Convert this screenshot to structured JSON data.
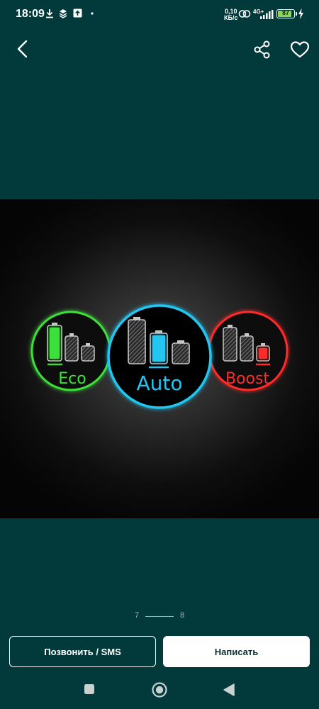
{
  "status_bar": {
    "time": "18:09",
    "net_speed_value": "0,10",
    "net_speed_unit": "КБ/с",
    "net_type": "4G+",
    "battery_level": 87,
    "battery_text": "87",
    "icons": [
      "download-icon",
      "layers-icon",
      "upload-box-icon",
      "dot-icon",
      "link-icon",
      "signal-icon",
      "charging-icon"
    ]
  },
  "top_bar": {
    "icons": [
      "back-arrow-icon",
      "share-icon",
      "heart-icon"
    ]
  },
  "image": {
    "modes": [
      "Eco",
      "Auto",
      "Boost"
    ],
    "colors": {
      "eco": "#3ee03a",
      "auto": "#22c6f0",
      "boost": "#ff2a2a",
      "outline": "#c8c8c8"
    }
  },
  "pager": {
    "current": "7",
    "total": "8"
  },
  "actions": {
    "call_label": "Позвонить / SMS",
    "write_label": "Написать"
  },
  "nav_bar": {
    "icons": [
      "recents-square-icon",
      "home-circle-icon",
      "back-triangle-icon"
    ]
  },
  "colors": {
    "background": "#023a3b",
    "battery_fill": "#8ed35b"
  }
}
